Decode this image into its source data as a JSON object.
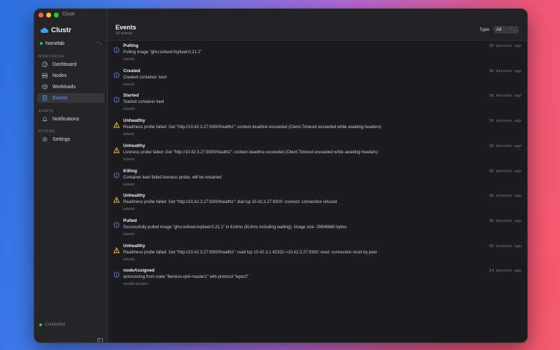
{
  "window": {
    "title": "Clustr"
  },
  "sidebar": {
    "brand": "Clustr",
    "cluster": "homelab",
    "sections": [
      {
        "title": "MONITORING",
        "items": [
          {
            "label": "Dashboard",
            "icon": "dashboard-icon"
          },
          {
            "label": "Nodes",
            "icon": "server-icon"
          },
          {
            "label": "Workloads",
            "icon": "cube-icon"
          },
          {
            "label": "Events",
            "icon": "document-icon",
            "active": true
          }
        ]
      },
      {
        "title": "ALERTS",
        "items": [
          {
            "label": "Notifications",
            "icon": "bell-icon"
          }
        ]
      },
      {
        "title": "SYSTEM",
        "items": [
          {
            "label": "Settings",
            "icon": "gear-icon"
          }
        ]
      }
    ],
    "status": "Connected"
  },
  "header": {
    "title": "Events",
    "count": "10 events",
    "type_label": "Type",
    "type_value": "All"
  },
  "colors": {
    "info": "#5b8cf7",
    "warning": "#f5c23b",
    "accent": "#5aa0ff",
    "connected": "#34c759"
  },
  "events": [
    {
      "type": "info",
      "reason": "Pulling",
      "message": "Pulling image \"ghcr.io/keel-hq/keel:0.21.1\"",
      "source": "kubelet",
      "time": "36 minutes ago"
    },
    {
      "type": "info",
      "reason": "Created",
      "message": "Created container: keel",
      "source": "kubelet",
      "time": "36 minutes ago"
    },
    {
      "type": "info",
      "reason": "Started",
      "message": "Started container keel",
      "source": "kubelet",
      "time": "36 minutes ago"
    },
    {
      "type": "warning",
      "reason": "Unhealthy",
      "message": "Readiness probe failed: Get \"http://10.42.3.27:9300/healthz\": context deadline exceeded (Client.Timeout exceeded while awaiting headers)",
      "source": "kubelet",
      "time": "36 minutes ago"
    },
    {
      "type": "warning",
      "reason": "Unhealthy",
      "message": "Liveness probe failed: Get \"http://10.42.3.27:9300/healthz\": context deadline exceeded (Client.Timeout exceeded while awaiting headers)",
      "source": "kubelet",
      "time": "36 minutes ago"
    },
    {
      "type": "info",
      "reason": "Killing",
      "message": "Container keel failed liveness probe, will be restarted",
      "source": "kubelet",
      "time": "36 minutes ago"
    },
    {
      "type": "warning",
      "reason": "Unhealthy",
      "message": "Readiness probe failed: Get \"http://10.42.3.27:9300/healthz\": dial tcp 10.42.3.27:9300: connect: connection refused",
      "source": "kubelet",
      "time": "36 minutes ago"
    },
    {
      "type": "info",
      "reason": "Pulled",
      "message": "Successfully pulled image \"ghcr.io/keel-hq/keel:0.21.1\" in 614ms (614ms including waiting). Image size: 29646680 bytes.",
      "source": "kubelet",
      "time": "36 minutes ago"
    },
    {
      "type": "warning",
      "reason": "Unhealthy",
      "message": "Readiness probe failed: Get \"http://10.42.3.27:9300/healthz\": read tcp 10.42.3.1:42332->10.42.3.27:9300: read: connection reset by peer",
      "source": "kubelet",
      "time": "36 minutes ago"
    },
    {
      "type": "info",
      "reason": "nodeAssigned",
      "message": "announcing from node \"lbenicio-rpi4-master1\" with protocol \"layer2\"",
      "source": "metallb-speaker",
      "time": "14 minutes ago"
    }
  ]
}
